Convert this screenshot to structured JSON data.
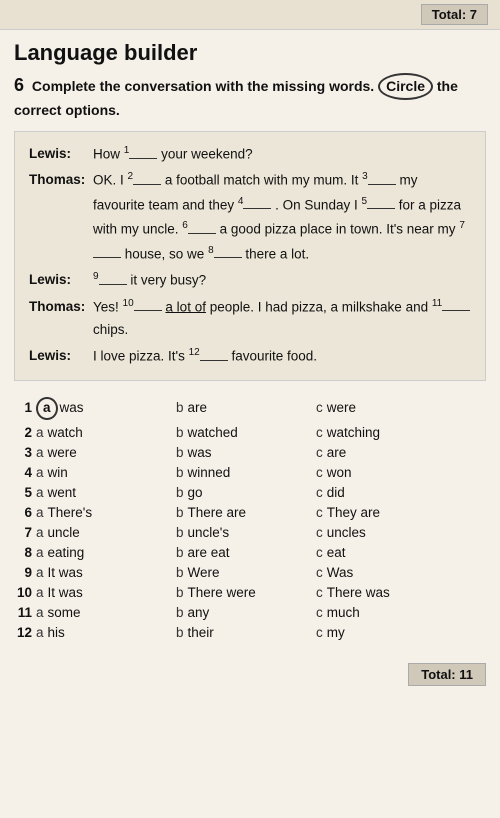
{
  "top_total": "Total: 7",
  "page_title": "Language builder",
  "section": {
    "number": "6",
    "instruction": "Complete the conversation with the missing words.",
    "circle_word": "Circle",
    "instruction2": "the correct options."
  },
  "conversation": [
    {
      "speaker": "Lewis:",
      "lines": [
        {
          "before": "How ",
          "sup": "1",
          "after": "__ your weekend?"
        }
      ]
    },
    {
      "speaker": "Thomas:",
      "lines": [
        {
          "before": "OK. I ",
          "sup": "2",
          "after": "__ a football match with my"
        },
        {
          "before": "mum. It ",
          "sup": "3",
          "after": "__ my favourite team and they"
        },
        {
          "before": "",
          "sup": "4",
          "after": "__ . On Sunday I ",
          "sup2": "5",
          "after2": "__ for a pizza with"
        },
        {
          "before": "my uncle. ",
          "sup": "6",
          "after": "__ a good pizza place in"
        },
        {
          "before": "town. It's near my ",
          "sup": "7",
          "after": "__ house, so we"
        },
        {
          "before": "",
          "sup": "8",
          "after": "__ there a lot."
        }
      ]
    },
    {
      "speaker": "Lewis:",
      "lines": [
        {
          "before": "",
          "sup": "9",
          "after": "__ it very busy?"
        }
      ]
    },
    {
      "speaker": "Thomas:",
      "lines": [
        {
          "before": "Yes! ",
          "sup": "10",
          "after": "__ a lot of people. I had pizza,",
          "underline": "a lot of"
        },
        {
          "before": "a milkshake and ",
          "sup": "11",
          "after": "__ chips."
        }
      ]
    },
    {
      "speaker": "Lewis:",
      "lines": [
        {
          "before": "I love pizza. It's ",
          "sup": "12",
          "after": "__ favourite food."
        }
      ]
    }
  ],
  "options": [
    {
      "num": "1",
      "a_circle": true,
      "a": "was",
      "b": "are",
      "c": "were"
    },
    {
      "num": "2",
      "a": "watch",
      "b": "watched",
      "c": "watching"
    },
    {
      "num": "3",
      "a": "were",
      "b": "was",
      "c": "are"
    },
    {
      "num": "4",
      "a": "win",
      "b": "winned",
      "c": "won"
    },
    {
      "num": "5",
      "a": "went",
      "b": "go",
      "c": "did"
    },
    {
      "num": "6",
      "a": "There's",
      "b": "There are",
      "c": "They are"
    },
    {
      "num": "7",
      "a": "uncle",
      "b": "uncle's",
      "c": "uncles"
    },
    {
      "num": "8",
      "a": "eating",
      "b": "are eat",
      "c": "eat"
    },
    {
      "num": "9",
      "a": "It was",
      "b": "Were",
      "c": "Was"
    },
    {
      "num": "10",
      "a": "It was",
      "b": "There were",
      "c": "There was"
    },
    {
      "num": "11",
      "a": "some",
      "b": "any",
      "c": "much"
    },
    {
      "num": "12",
      "a": "his",
      "b": "their",
      "c": "my"
    }
  ],
  "bottom_total": "Total: 11"
}
